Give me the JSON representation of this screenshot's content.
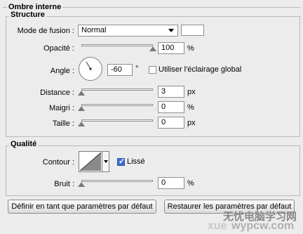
{
  "panel": {
    "title": "Ombre interne",
    "structure": {
      "legend": "Structure",
      "blend_mode": {
        "label": "Mode de fusion :",
        "value": "Normal"
      },
      "color_swatch_color": "#ffffff",
      "opacity": {
        "label": "Opacité :",
        "value": "100",
        "unit": "%",
        "level": 1.0
      },
      "angle": {
        "label": "Angle :",
        "value": "-60",
        "unit": "°"
      },
      "global_light": {
        "label": "Utiliser l'éclairage global",
        "checked": false
      },
      "distance": {
        "label": "Distance :",
        "value": "3",
        "unit": "px",
        "level": 0.0
      },
      "choke": {
        "label": "Maigri :",
        "value": "0",
        "unit": "%",
        "level": 0.0
      },
      "size": {
        "label": "Taille :",
        "value": "0",
        "unit": "px",
        "level": 0.0
      }
    },
    "quality": {
      "legend": "Qualité",
      "contour_label": "Contour :",
      "antialias": {
        "label": "Lissé",
        "checked": true
      },
      "noise": {
        "label": "Bruit :",
        "value": "0",
        "unit": "%",
        "level": 0.0
      }
    },
    "buttons": {
      "set_default": "Définir en tant que paramètres par défaut",
      "reset_default": "Restaurer les paramètres par défaut"
    }
  },
  "watermark": {
    "line1": "无忧电脑学习网",
    "line2": "wypcw.com",
    "faint": "xue"
  },
  "colors": {
    "background": "#ececec",
    "checkbox_checked": "#3d6fcc"
  }
}
